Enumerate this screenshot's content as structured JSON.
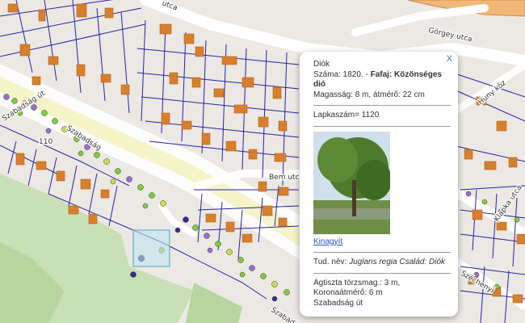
{
  "map": {
    "streets": {
      "gorgey": "Görgey utca",
      "szabadsag_ut": "Szabadság út",
      "szabadsag_ut_2": "Szabadság",
      "szabadsag_ut_3": "Szabad",
      "bem": "Bem utca",
      "huny": "Huny köz",
      "klapka": "Klapka utca",
      "szechenyi": "Széchenyi",
      "top_fragment": "utca"
    },
    "labels": {
      "house_number": "110"
    },
    "colors": {
      "building": "#d97f2c",
      "parcel_line": "#1a1aa8",
      "road": "#ffffff",
      "green_area": "#c3dcb0",
      "tree_dot_green": "#7fcf3a",
      "tree_dot_purple": "#9a6fd0"
    }
  },
  "popup": {
    "close_label": "X",
    "species_title": "Diók",
    "number_prefix": "Száma: 1820. - ",
    "species_label": "Fafaj: Közönséges dió",
    "dimensions": "Magasság: 8 m, átmérő: 22 cm",
    "parcel": "Lapkaszám= 1120",
    "enlarge_link": "Kinagyít",
    "scientific_prefix": "Tud. név: ",
    "scientific_value": "Juglans regia Család: Diók",
    "trunk": "Ágtiszta törzsmag.: 3 m,",
    "crown": "Koronaátmérő: 6 m",
    "location": "Szabadság út"
  }
}
